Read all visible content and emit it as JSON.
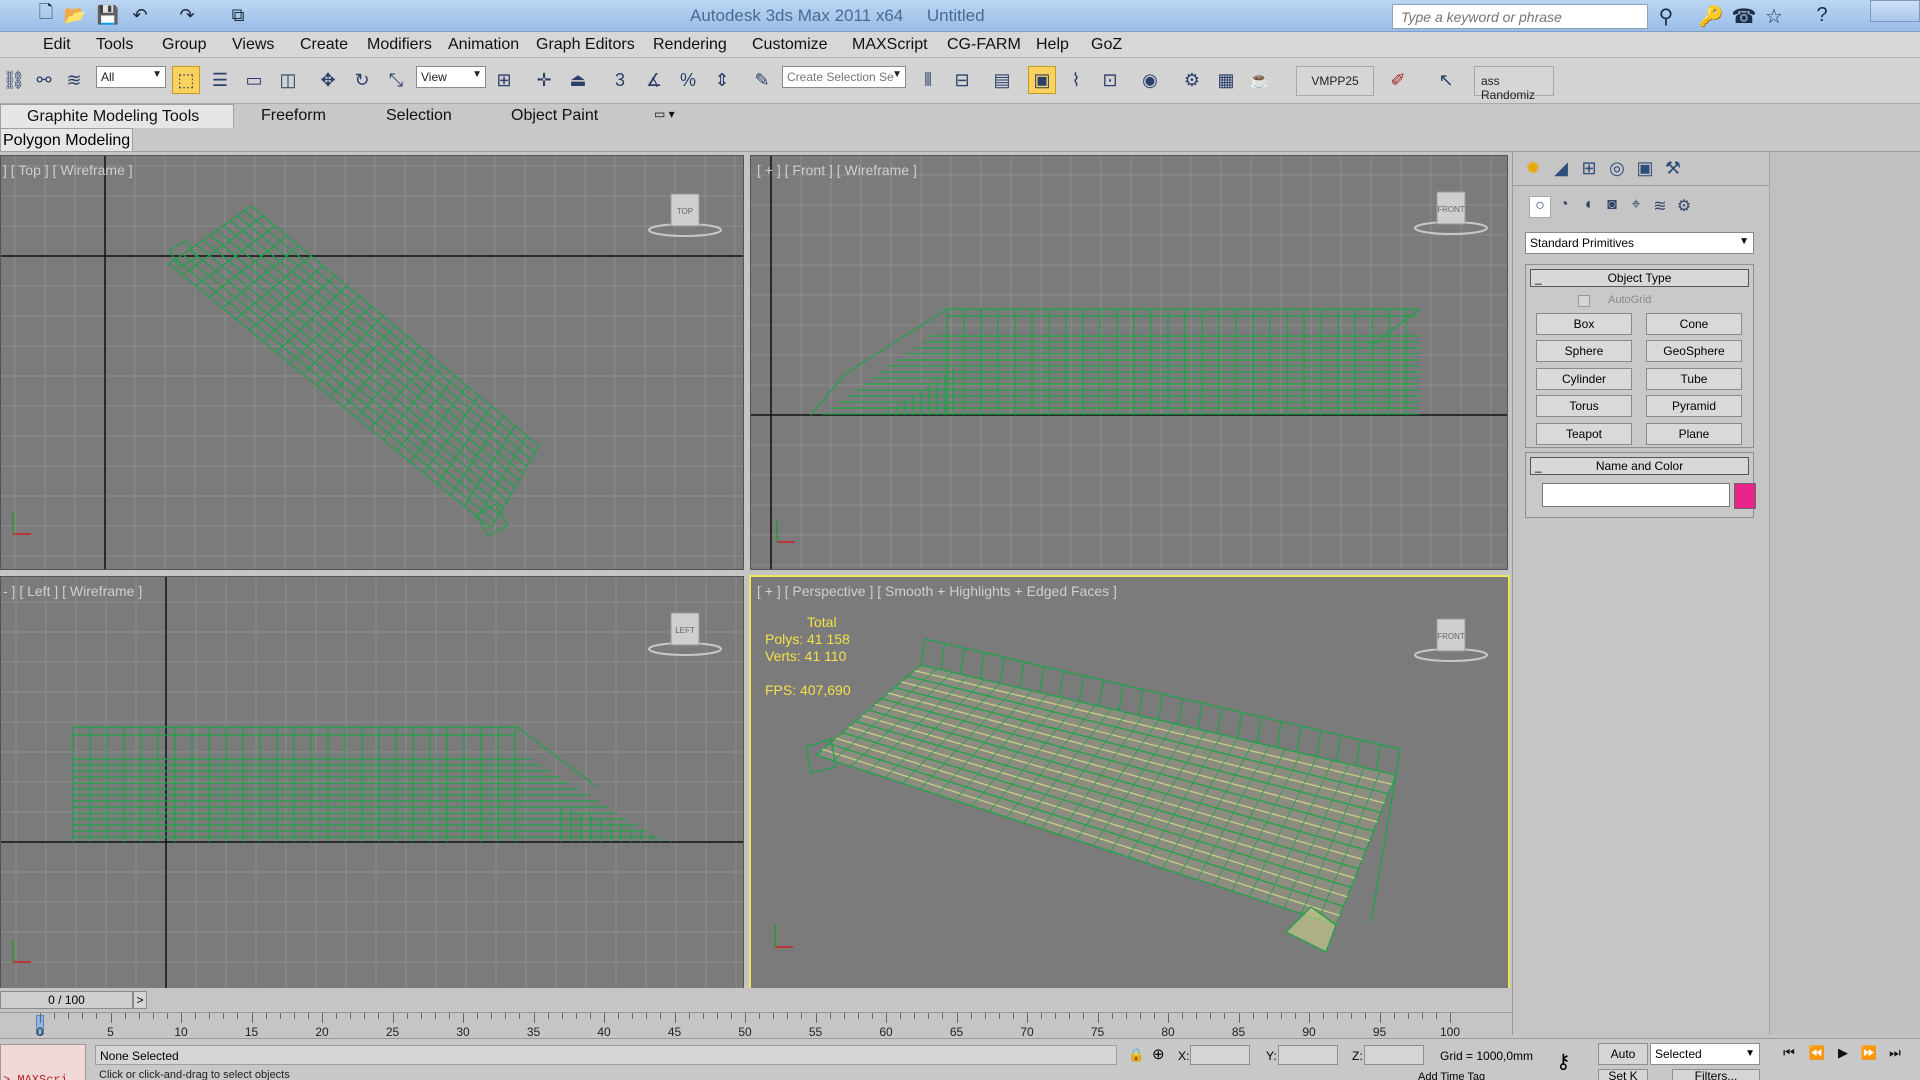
{
  "window": {
    "title": "Autodesk 3ds Max 2011 x64",
    "doc": "Untitled"
  },
  "search": {
    "placeholder": "Type a keyword or phrase"
  },
  "menu": [
    "Edit",
    "Tools",
    "Group",
    "Views",
    "Create",
    "Modifiers",
    "Animation",
    "Graph Editors",
    "Rendering",
    "Customize",
    "MAXScript",
    "CG-FARM",
    "Help",
    "GoZ"
  ],
  "toolbar": {
    "selection_filter": "All",
    "ref_coord": "View",
    "named_selection_placeholder": "Create Selection Se",
    "snap_label": "3",
    "angle_snap_label": "",
    "vmpp_label": "VMPP25",
    "randomizer_label": "ass Randomiz"
  },
  "ribbon": {
    "tabs": [
      "Graphite Modeling Tools",
      "Freeform",
      "Selection",
      "Object Paint"
    ],
    "panel": "Polygon Modeling"
  },
  "viewports": {
    "top": {
      "label": "] [ Top ] [ Wireframe ]",
      "cube": "TOP"
    },
    "front": {
      "label": "[ + ] [ Front ] [ Wireframe ]",
      "cube": "FRONT"
    },
    "left": {
      "label": "- ] [ Left ] [ Wireframe ]",
      "cube": "LEFT"
    },
    "perspective": {
      "label": "[ + ] [ Perspective ] [ Smooth + Highlights + Edged Faces ]",
      "cube": "FRONT",
      "stats": {
        "total": "Total",
        "polys": "Polys:  41 158",
        "verts": "Verts:  41 110",
        "fps": "FPS:    407,690"
      }
    }
  },
  "command_panel": {
    "category": "Standard Primitives",
    "object_type_title": "Object Type",
    "autogrid": "AutoGrid",
    "buttons": [
      "Box",
      "Cone",
      "Sphere",
      "GeoSphere",
      "Cylinder",
      "Tube",
      "Torus",
      "Pyramid",
      "Teapot",
      "Plane"
    ],
    "name_color_title": "Name and Color",
    "object_color": "#e8238a"
  },
  "timeline": {
    "counter": "0 / 100",
    "next": ">",
    "ticks": [
      "0",
      "5",
      "10",
      "15",
      "20",
      "25",
      "30",
      "35",
      "40",
      "45",
      "50",
      "55",
      "60",
      "65",
      "70",
      "75",
      "80",
      "85",
      "90",
      "95",
      "100"
    ]
  },
  "status": {
    "maxscript": "> MAXScri",
    "selection": "None Selected",
    "prompt": "Click or click-and-drag to select objects",
    "x_label": "X:",
    "y_label": "Y:",
    "z_label": "Z:",
    "grid": "Grid = 1000,0mm",
    "auto_key": "Auto",
    "set_key": "Set K",
    "key_filter": "Selected",
    "filters": "Filters...",
    "add_time_tag": "Add Time Tag"
  },
  "colors": {
    "wire": "#1ea24a",
    "viewport_bg": "#7b7b7b",
    "active_border": "#f2e15c",
    "stats": "#f4e049"
  }
}
